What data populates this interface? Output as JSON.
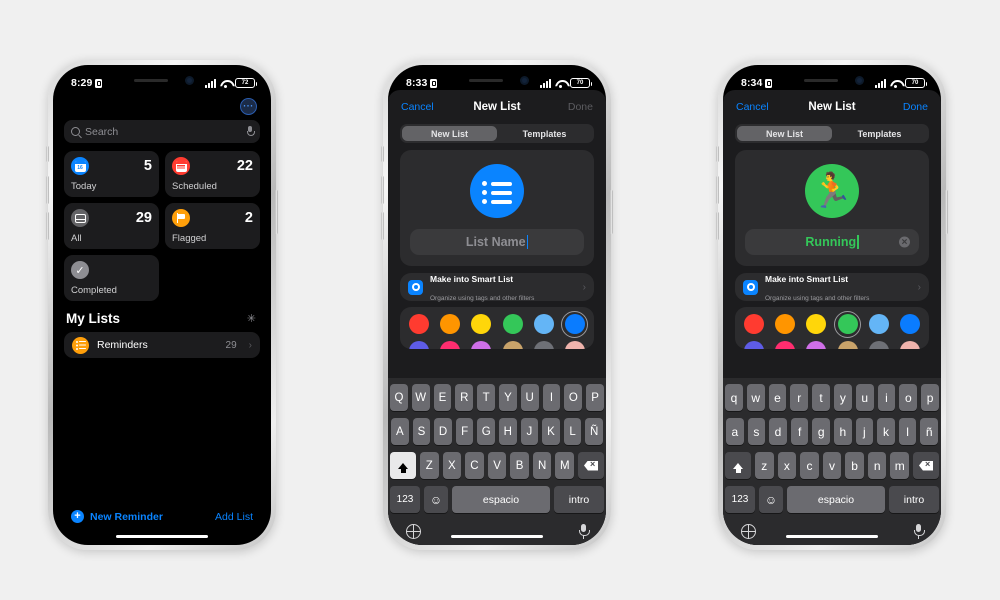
{
  "phones": [
    {
      "status": {
        "time": "8:29",
        "lock_icon": "lock-icon",
        "battery_level": "72"
      },
      "screen": "reminders-home",
      "more_button": "···",
      "search": {
        "placeholder": "Search",
        "icon": "search-icon",
        "mic_icon": "microphone-icon"
      },
      "cards": [
        {
          "label": "Today",
          "count": "5",
          "icon": "calendar-today-icon",
          "color": "#0a84ff"
        },
        {
          "label": "Scheduled",
          "count": "22",
          "icon": "calendar-scheduled-icon",
          "color": "#ff3b30"
        },
        {
          "label": "All",
          "count": "29",
          "icon": "tray-icon",
          "color": "#636366"
        },
        {
          "label": "Flagged",
          "count": "2",
          "icon": "flag-icon",
          "color": "#ff9f0a"
        },
        {
          "label": "Completed",
          "count": "",
          "icon": "checkmark-icon",
          "color": "#8e8e93"
        }
      ],
      "section": {
        "title": "My Lists",
        "sparkle_icon": "sparkle-icon"
      },
      "lists": [
        {
          "name": "Reminders",
          "count": "29",
          "icon": "bulleted-list-icon",
          "color": "#ff9f0a",
          "chevron": "›"
        }
      ],
      "footer": {
        "new_reminder": "New Reminder",
        "plus": "+",
        "add_list": "Add List"
      }
    },
    {
      "status": {
        "time": "8:33",
        "lock_icon": "lock-icon",
        "battery_level": "70"
      },
      "screen": "new-list-empty",
      "nav": {
        "cancel": "Cancel",
        "title": "New List",
        "done": "Done",
        "done_enabled": false
      },
      "segments": [
        {
          "label": "New List",
          "active": true
        },
        {
          "label": "Templates",
          "active": false
        }
      ],
      "list_icon": {
        "type": "bulleted-list-icon",
        "color": "#0a84ff"
      },
      "name_field": {
        "value": "",
        "placeholder": "List Name",
        "has_clear": false
      },
      "smart_list": {
        "title": "Make into Smart List",
        "subtitle": "Organize using tags and other filters",
        "icon": "smart-list-icon",
        "chevron": "›"
      },
      "colors_row1": [
        "#ff3b30",
        "#ff9500",
        "#ffd60a",
        "#34c759",
        "#64b5f6",
        "#0a7cff"
      ],
      "colors_row2": [
        "#5e5ce6",
        "#ff2d6f",
        "#cf6fe8",
        "#c9a36a",
        "#6e7076",
        "#efb3ac"
      ],
      "selected_color_index": 5,
      "keyboard": {
        "shift_active": true,
        "row1": [
          "Q",
          "W",
          "E",
          "R",
          "T",
          "Y",
          "U",
          "I",
          "O",
          "P"
        ],
        "row2": [
          "A",
          "S",
          "D",
          "F",
          "G",
          "H",
          "J",
          "K",
          "L",
          "Ñ"
        ],
        "row3": [
          "Z",
          "X",
          "C",
          "V",
          "B",
          "N",
          "M"
        ],
        "shift_icon": "shift-icon",
        "delete_icon": "delete-icon",
        "numbers_key": "123",
        "emoji_key": "emoji-icon",
        "space_key": "espacio",
        "enter_key": "intro",
        "globe_icon": "globe-icon",
        "dictation_icon": "microphone-icon"
      }
    },
    {
      "status": {
        "time": "8:34",
        "lock_icon": "lock-icon",
        "battery_level": "70"
      },
      "screen": "new-list-named",
      "nav": {
        "cancel": "Cancel",
        "title": "New List",
        "done": "Done",
        "done_enabled": true
      },
      "segments": [
        {
          "label": "New List",
          "active": true
        },
        {
          "label": "Templates",
          "active": false
        }
      ],
      "list_icon": {
        "type": "running-person-icon",
        "glyph": "🏃",
        "color": "#34c759"
      },
      "name_field": {
        "value": "Running",
        "placeholder": "List Name",
        "has_clear": true,
        "clear_icon": "clear-text-icon"
      },
      "smart_list": {
        "title": "Make into Smart List",
        "subtitle": "Organize using tags and other filters",
        "icon": "smart-list-icon",
        "chevron": "›"
      },
      "colors_row1": [
        "#ff3b30",
        "#ff9500",
        "#ffd60a",
        "#34c759",
        "#64b5f6",
        "#0a7cff"
      ],
      "colors_row2": [
        "#5e5ce6",
        "#ff2d6f",
        "#cf6fe8",
        "#c9a36a",
        "#6e7076",
        "#efb3ac"
      ],
      "selected_color_index": 3,
      "keyboard": {
        "shift_active": false,
        "row1": [
          "q",
          "w",
          "e",
          "r",
          "t",
          "y",
          "u",
          "i",
          "o",
          "p"
        ],
        "row2": [
          "a",
          "s",
          "d",
          "f",
          "g",
          "h",
          "j",
          "k",
          "l",
          "ñ"
        ],
        "row3": [
          "z",
          "x",
          "c",
          "v",
          "b",
          "n",
          "m"
        ],
        "shift_icon": "shift-icon",
        "delete_icon": "delete-icon",
        "numbers_key": "123",
        "emoji_key": "emoji-icon",
        "space_key": "espacio",
        "enter_key": "intro",
        "globe_icon": "globe-icon",
        "dictation_icon": "microphone-icon"
      }
    }
  ]
}
